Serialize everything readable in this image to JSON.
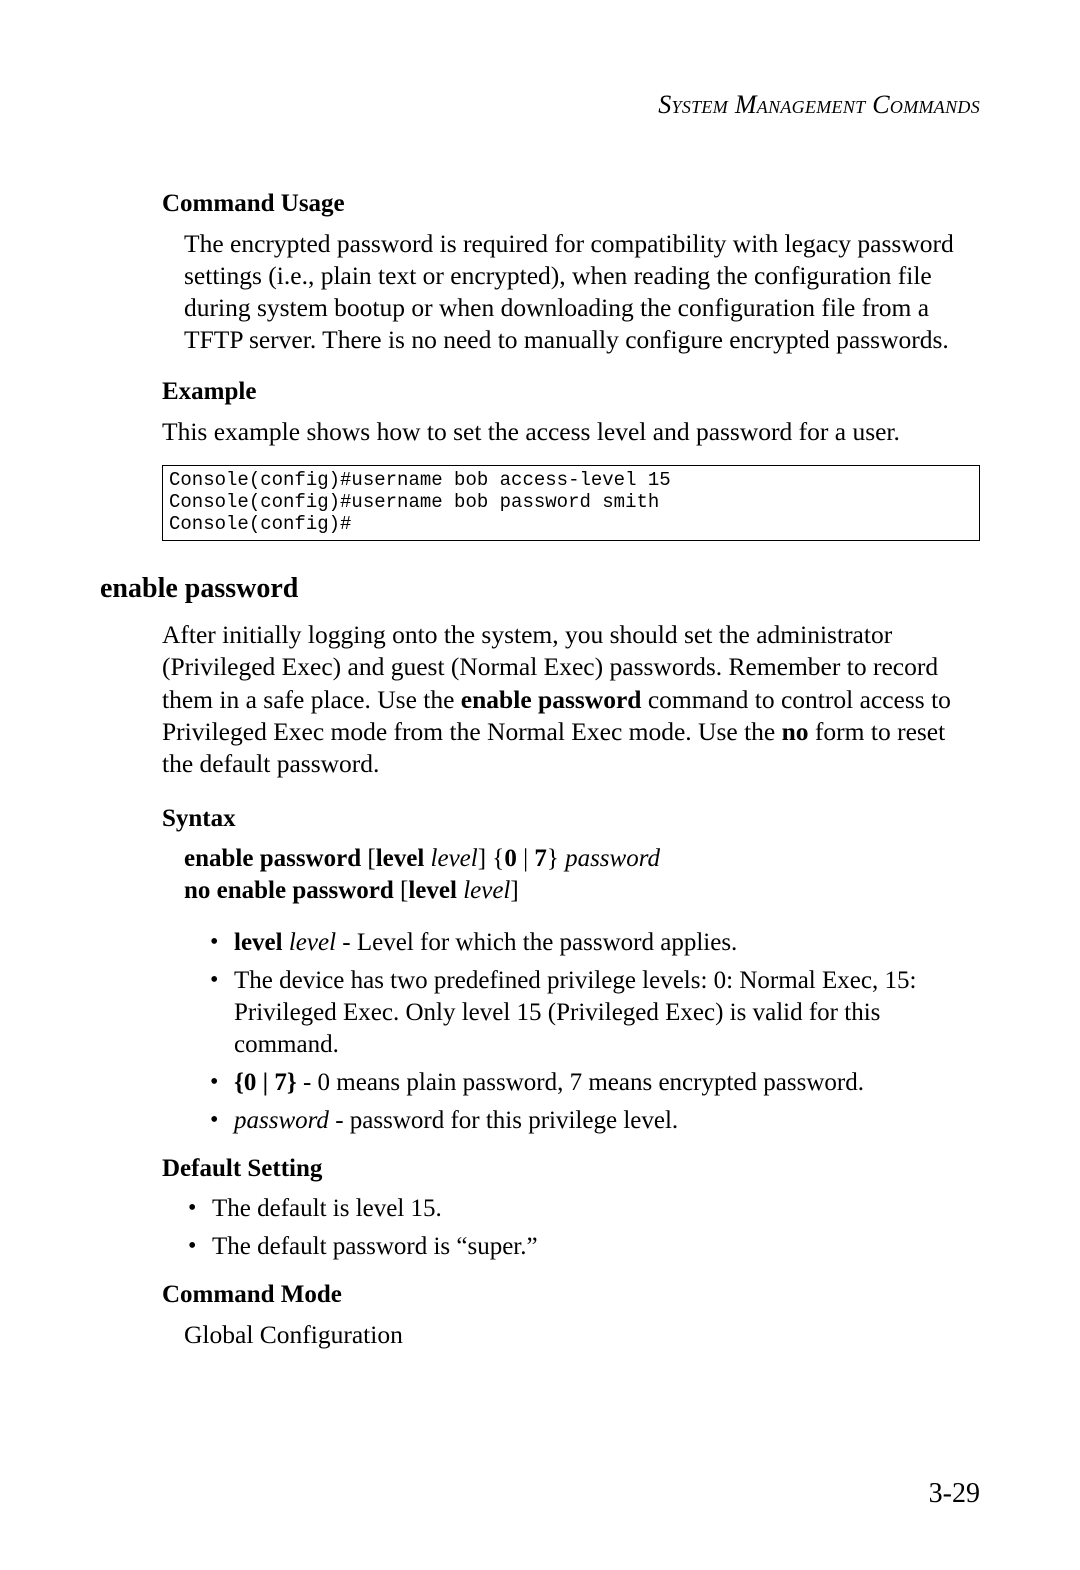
{
  "running_head": "System Management Commands",
  "command_usage": {
    "heading": "Command Usage",
    "text": "The encrypted password is required for compatibility with legacy password settings (i.e., plain text or encrypted), when reading the configuration file during system bootup or when downloading the configuration file from a TFTP server. There is no need to manually configure encrypted passwords."
  },
  "example": {
    "heading": "Example",
    "intro": "This example shows how to set the access level and password for a user.",
    "code": "Console(config)#username bob access-level 15\nConsole(config)#username bob password smith\nConsole(config)#"
  },
  "enable_password": {
    "title": "enable password",
    "intro_pre": "After initially logging onto the system, you should set the administrator (Privileged Exec) and guest (Normal Exec) passwords. Remember to record them in a safe place. Use the ",
    "intro_cmd": "enable password",
    "intro_mid": " command to control access to Privileged Exec mode from the Normal Exec mode. Use the ",
    "intro_no": "no",
    "intro_post": " form to reset the default password."
  },
  "syntax": {
    "heading": "Syntax",
    "l1_a": "enable password",
    "l1_b": " [",
    "l1_c": "level",
    "l1_d": " ",
    "l1_e": "level",
    "l1_f": "] {",
    "l1_g": "0",
    "l1_h": " | ",
    "l1_i": "7",
    "l1_j": "} ",
    "l1_k": "password",
    "l2_a": "no enable password",
    "l2_b": " [",
    "l2_c": "level",
    "l2_d": " ",
    "l2_e": "level",
    "l2_f": "]",
    "bullets": {
      "b1_a": "level",
      "b1_b": " ",
      "b1_c": "level",
      "b1_d": " - Level for which the password applies.",
      "b2": "The device has two predefined privilege levels: 0: Normal Exec, 15: Privileged Exec. Only level 15 (Privileged Exec) is valid for this command.",
      "b3_a": "{0 | 7}",
      "b3_b": " - 0 means plain password, 7 means encrypted password.",
      "b4_a": "password",
      "b4_b": " - password for this privilege level."
    }
  },
  "default_setting": {
    "heading": "Default Setting",
    "items": {
      "i1": "The default is level 15.",
      "i2": "The default password is “super.”"
    }
  },
  "command_mode": {
    "heading": "Command Mode",
    "text": "Global Configuration"
  },
  "page_number": "3-29"
}
